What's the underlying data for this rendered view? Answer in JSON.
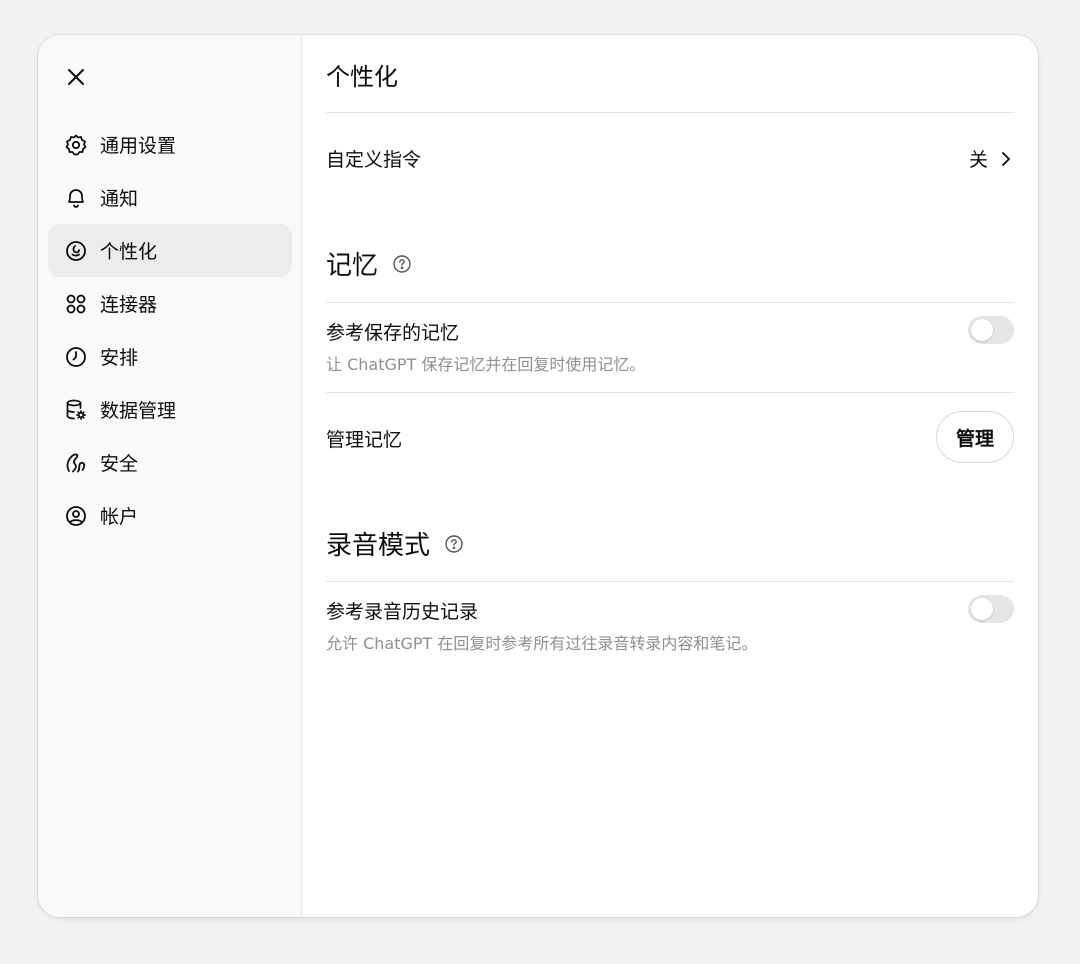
{
  "sidebar": {
    "items": [
      {
        "label": "通用设置",
        "icon": "gear-icon"
      },
      {
        "label": "通知",
        "icon": "bell-icon"
      },
      {
        "label": "个性化",
        "icon": "personalization-icon"
      },
      {
        "label": "连接器",
        "icon": "connectors-icon"
      },
      {
        "label": "安排",
        "icon": "clock-icon"
      },
      {
        "label": "数据管理",
        "icon": "database-icon"
      },
      {
        "label": "安全",
        "icon": "security-icon"
      },
      {
        "label": "帐户",
        "icon": "account-icon"
      }
    ],
    "active_index": 2
  },
  "main": {
    "title": "个性化",
    "custom_instructions": {
      "label": "自定义指令",
      "value": "关"
    },
    "memory": {
      "title": "记忆",
      "reference_saved": {
        "title": "参考保存的记忆",
        "desc": "让 ChatGPT 保存记忆并在回复时使用记忆。",
        "enabled": false
      },
      "manage": {
        "label": "管理记忆",
        "button": "管理"
      }
    },
    "recording": {
      "title": "录音模式",
      "reference_history": {
        "title": "参考录音历史记录",
        "desc": "允许 ChatGPT 在回复时参考所有过往录音转录内容和笔记。",
        "enabled": false
      }
    }
  },
  "colors": {
    "sidebar_bg": "#f9f9f9",
    "active_bg": "#ececec",
    "toggle_off": "#e5e5e5",
    "muted_text": "#8f8f8f"
  }
}
